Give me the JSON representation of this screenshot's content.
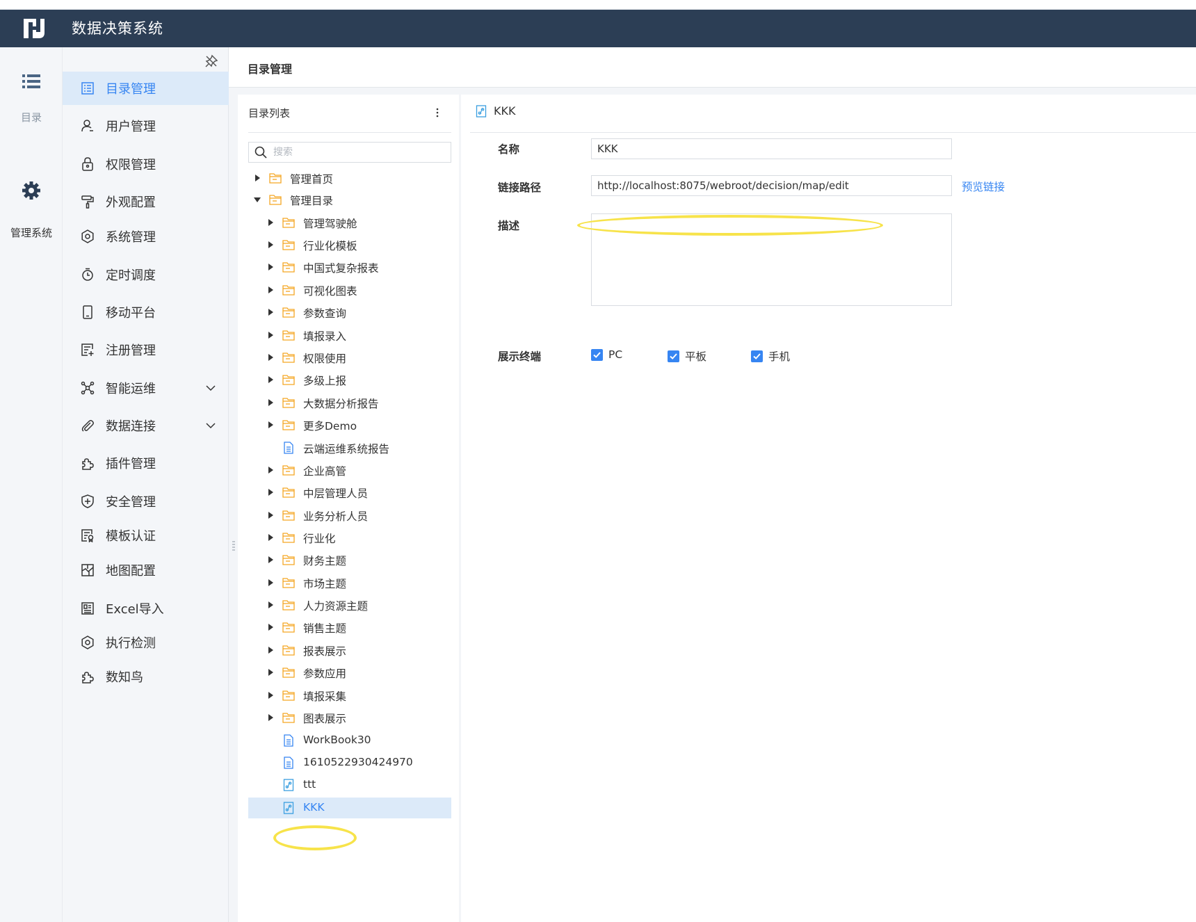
{
  "app": {
    "title": "数据决策系统"
  },
  "rail": {
    "items": [
      {
        "label": "目录",
        "icon": "list-icon"
      },
      {
        "label": "管理系统",
        "icon": "gear-icon"
      }
    ]
  },
  "nav": {
    "items": [
      {
        "label": "目录管理",
        "icon": "directory-icon",
        "active": true
      },
      {
        "label": "用户管理",
        "icon": "user-icon"
      },
      {
        "label": "权限管理",
        "icon": "lock-icon"
      },
      {
        "label": "外观配置",
        "icon": "paint-roller-icon"
      },
      {
        "label": "系统管理",
        "icon": "settings-icon"
      },
      {
        "label": "定时调度",
        "icon": "timer-icon"
      },
      {
        "label": "移动平台",
        "icon": "mobile-icon"
      },
      {
        "label": "注册管理",
        "icon": "register-icon"
      },
      {
        "label": "智能运维",
        "icon": "network-icon",
        "expandable": true
      },
      {
        "label": "数据连接",
        "icon": "paperclip-icon",
        "expandable": true
      },
      {
        "label": "插件管理",
        "icon": "puzzle-icon"
      },
      {
        "label": "安全管理",
        "icon": "shield-icon"
      },
      {
        "label": "模板认证",
        "icon": "certificate-icon"
      },
      {
        "label": "地图配置",
        "icon": "map-icon"
      },
      {
        "label": "Excel导入",
        "icon": "excel-import-icon"
      },
      {
        "label": "执行检测",
        "icon": "settings-icon"
      },
      {
        "label": "数知鸟",
        "icon": "puzzle-icon"
      }
    ]
  },
  "breadcrumb": {
    "title": "目录管理"
  },
  "tree": {
    "title": "目录列表",
    "search_placeholder": "搜索",
    "rows": [
      {
        "label": "管理首页",
        "level": 0,
        "type": "folder",
        "state": "collapsed"
      },
      {
        "label": "管理目录",
        "level": 0,
        "type": "folder",
        "state": "expanded"
      },
      {
        "label": "管理驾驶舱",
        "level": 1,
        "type": "folder",
        "state": "collapsed"
      },
      {
        "label": "行业化模板",
        "level": 1,
        "type": "folder",
        "state": "collapsed"
      },
      {
        "label": "中国式复杂报表",
        "level": 1,
        "type": "folder",
        "state": "collapsed"
      },
      {
        "label": "可视化图表",
        "level": 1,
        "type": "folder",
        "state": "collapsed"
      },
      {
        "label": "参数查询",
        "level": 1,
        "type": "folder",
        "state": "collapsed"
      },
      {
        "label": "填报录入",
        "level": 1,
        "type": "folder",
        "state": "collapsed"
      },
      {
        "label": "权限使用",
        "level": 1,
        "type": "folder",
        "state": "collapsed"
      },
      {
        "label": "多级上报",
        "level": 1,
        "type": "folder",
        "state": "collapsed"
      },
      {
        "label": "大数据分析报告",
        "level": 1,
        "type": "folder",
        "state": "collapsed"
      },
      {
        "label": "更多Demo",
        "level": 1,
        "type": "folder",
        "state": "collapsed"
      },
      {
        "label": "云端运维系统报告",
        "level": 1,
        "type": "file"
      },
      {
        "label": "企业高管",
        "level": 1,
        "type": "folder",
        "state": "collapsed"
      },
      {
        "label": "中层管理人员",
        "level": 1,
        "type": "folder",
        "state": "collapsed"
      },
      {
        "label": "业务分析人员",
        "level": 1,
        "type": "folder",
        "state": "collapsed"
      },
      {
        "label": "行业化",
        "level": 1,
        "type": "folder",
        "state": "collapsed"
      },
      {
        "label": "财务主题",
        "level": 1,
        "type": "folder",
        "state": "collapsed"
      },
      {
        "label": "市场主题",
        "level": 1,
        "type": "folder",
        "state": "collapsed"
      },
      {
        "label": "人力资源主题",
        "level": 1,
        "type": "folder",
        "state": "collapsed"
      },
      {
        "label": "销售主题",
        "level": 1,
        "type": "folder",
        "state": "collapsed"
      },
      {
        "label": "报表展示",
        "level": 1,
        "type": "folder",
        "state": "collapsed"
      },
      {
        "label": "参数应用",
        "level": 1,
        "type": "folder",
        "state": "collapsed"
      },
      {
        "label": "填报采集",
        "level": 1,
        "type": "folder",
        "state": "collapsed"
      },
      {
        "label": "图表展示",
        "level": 1,
        "type": "folder",
        "state": "collapsed"
      },
      {
        "label": "WorkBook30",
        "level": 1,
        "type": "file"
      },
      {
        "label": "1610522930424970",
        "level": 1,
        "type": "file"
      },
      {
        "label": "ttt",
        "level": 1,
        "type": "link"
      },
      {
        "label": "KKK",
        "level": 1,
        "type": "link",
        "selected": true
      }
    ]
  },
  "detail": {
    "title": "KKK",
    "name_label": "名称",
    "name_value": "KKK",
    "path_label": "链接路径",
    "path_value": "http://localhost:8075/webroot/decision/map/edit",
    "preview_link": "预览链接",
    "desc_label": "描述",
    "desc_value": "",
    "terminal_label": "展示终端",
    "terminals": [
      {
        "label": "PC",
        "checked": true
      },
      {
        "label": "平板",
        "checked": true
      },
      {
        "label": "手机",
        "checked": true
      }
    ]
  },
  "colors": {
    "header_bg": "#2c3e55",
    "accent": "#3685f2",
    "folder": "#f5a623",
    "active_bg": "#dceaf9",
    "highlight_ring": "#f7e34a"
  }
}
